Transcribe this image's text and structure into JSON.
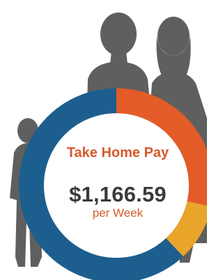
{
  "summary": {
    "title": "Take Home Pay",
    "amount": "$1,166.59",
    "period": "per Week"
  },
  "chart_data": {
    "type": "pie",
    "donut": true,
    "slices": [
      {
        "value": 0.285,
        "color": "#e35c28"
      },
      {
        "value": 0.095,
        "color": "#e9a42a"
      },
      {
        "value": 0.62,
        "color": "#1c5f8f"
      }
    ]
  },
  "colors": {
    "title": "#d65a2a",
    "amount": "#3a3a3a",
    "period": "#d65a2a",
    "silhouette": "#5f5f5f",
    "background": "#ffffff"
  }
}
